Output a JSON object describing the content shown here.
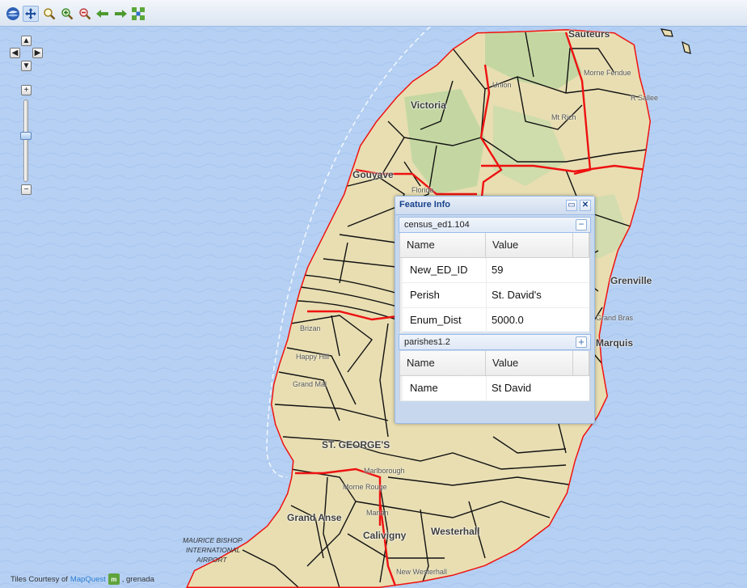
{
  "toolbar": {
    "tools": [
      {
        "name": "globe-icon"
      },
      {
        "name": "pan-icon",
        "active": true
      },
      {
        "name": "zoom-box-icon"
      },
      {
        "name": "zoom-in-icon"
      },
      {
        "name": "zoom-out-icon"
      },
      {
        "name": "back-arrow-icon"
      },
      {
        "name": "forward-arrow-icon"
      },
      {
        "name": "zoom-extent-icon"
      }
    ]
  },
  "map": {
    "places": {
      "sauteurs": "Sauteurs",
      "victoria": "Victoria",
      "union": "Union",
      "morne_fendue": "Morne Fendue",
      "mt_rich": "Mt Rich",
      "river_sallee": "R Sallee",
      "gouyave": "Gouyave",
      "florida": "Florida",
      "grenville": "Grenville",
      "la_poterie": "Grand Bras",
      "marquis": "Marquis",
      "telescope": "Telescope",
      "brizan": "Brizan",
      "happy_hill": "Happy Hill",
      "grand_mal": "Grand Mal",
      "st_georges": "ST. GEORGE'S",
      "marlborough": "Marlborough",
      "morne_rouge": "Morne Rouge",
      "grand_anse": "Grand Anse",
      "marian": "Marian",
      "calivigny": "Calivigny",
      "westerhall": "Westerhall",
      "new_westerhall": "New Westerhall",
      "airport_name": "MAURICE BISHOP",
      "airport_sub1": "INTERNATIONAL",
      "airport_sub2": "AIRPORT",
      "sauteurs_bay": "Sauteurs"
    },
    "colors": {
      "sea": "#b5d0f3",
      "land": "#e8deb2",
      "forest": "#c4d7a2",
      "parish_border": "#ee1111",
      "ed_border": "#111111"
    }
  },
  "attribution": {
    "prefix": "Tiles Courtesy of",
    "link": "MapQuest",
    "suffix": ", grenada"
  },
  "feature_info": {
    "title": "Feature Info",
    "sections": [
      {
        "name": "census_ed1.104",
        "expanded": true,
        "columns": [
          "Name",
          "Value"
        ],
        "rows": [
          {
            "name": "New_ED_ID",
            "value": "59"
          },
          {
            "name": "Perish",
            "value": "St. David's"
          },
          {
            "name": "Enum_Dist",
            "value": "5000.0"
          }
        ]
      },
      {
        "name": "parishes1.2",
        "expanded": false,
        "columns": [
          "Name",
          "Value"
        ],
        "rows": [
          {
            "name": "Name",
            "value": "St David"
          }
        ]
      }
    ]
  }
}
